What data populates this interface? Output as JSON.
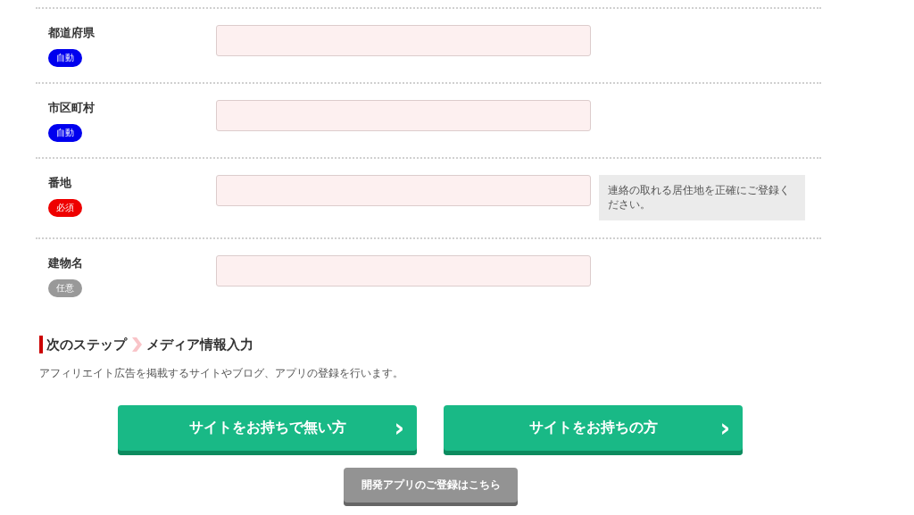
{
  "fields": [
    {
      "label": "都道府県",
      "badge": {
        "text": "自動",
        "kind": "auto"
      }
    },
    {
      "label": "市区町村",
      "badge": {
        "text": "自動",
        "kind": "auto"
      }
    },
    {
      "label": "番地",
      "badge": {
        "text": "必須",
        "kind": "required"
      },
      "note": "連絡の取れる居住地を正確にご登録ください。"
    },
    {
      "label": "建物名",
      "badge": {
        "text": "任意",
        "kind": "optional"
      }
    }
  ],
  "next_step": {
    "label": "次のステップ",
    "title": "メディア情報入力",
    "description": "アフィリエイト広告を掲載するサイトやブログ、アプリの登録を行います。"
  },
  "buttons": [
    {
      "label": "サイトをお持ちで無い方",
      "icon": "›"
    },
    {
      "label": "サイトをお持ちの方",
      "icon": "›"
    }
  ],
  "app_link": {
    "label": "開発アプリのご登録はこちら"
  }
}
